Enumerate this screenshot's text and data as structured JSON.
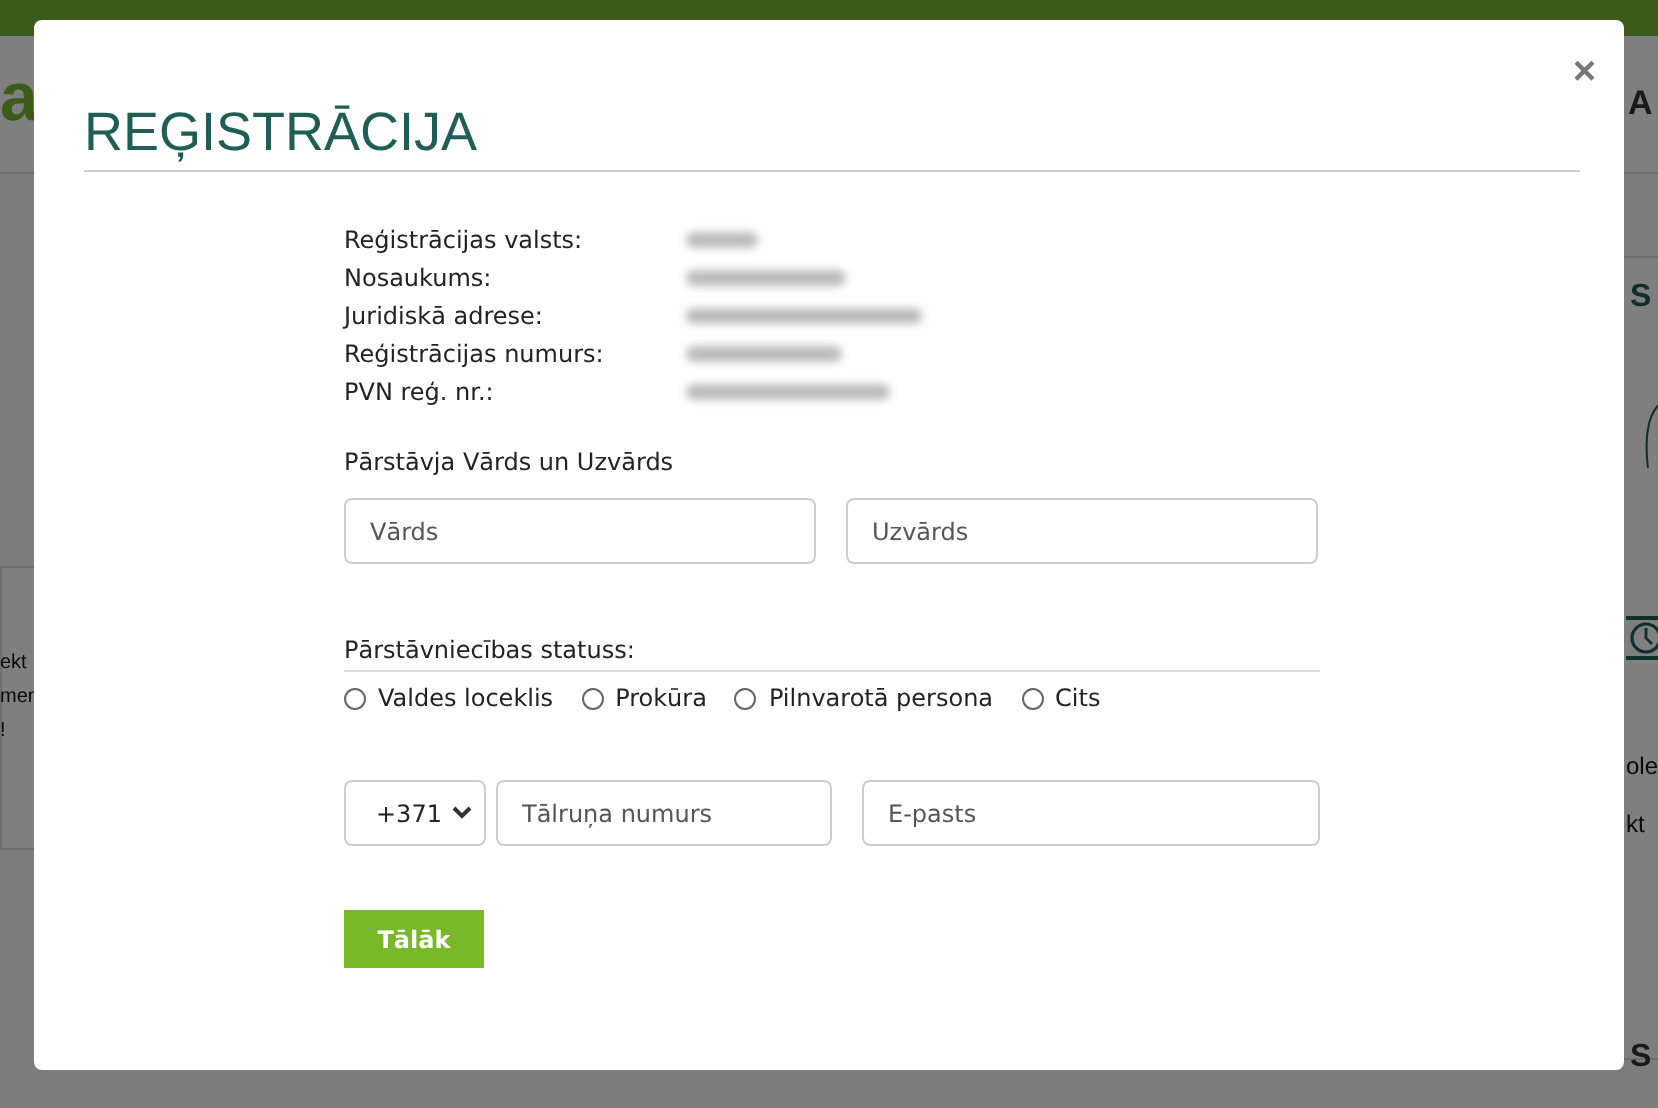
{
  "background_page": {
    "logo_fragment": "a",
    "fragments": [
      {
        "text": "A",
        "kind": "nav"
      },
      {
        "text": "S",
        "kind": "heading"
      },
      {
        "text": "ekt",
        "kind": "left"
      },
      {
        "text": "men",
        "kind": "left"
      },
      {
        "text": "!",
        "kind": "left"
      },
      {
        "text": "ole",
        "kind": "right"
      },
      {
        "text": "kt",
        "kind": "right"
      },
      {
        "text": "S",
        "kind": "bottom"
      }
    ]
  },
  "modal": {
    "title": "REĢISTRĀCIJA",
    "close": "×",
    "details": [
      {
        "label": "Reģistrācijas valsts:",
        "redacted": true
      },
      {
        "label": "Nosaukums:",
        "redacted": true
      },
      {
        "label": "Juridiskā adrese:",
        "redacted": true
      },
      {
        "label": "Reģistrācijas numurs:",
        "redacted": true
      },
      {
        "label": "PVN reģ. nr.:",
        "redacted": true
      }
    ],
    "name_section": {
      "label": "Pārstāvja Vārds un Uzvārds",
      "fields": [
        {
          "placeholder": "Vārds"
        },
        {
          "placeholder": "Uzvārds"
        }
      ]
    },
    "status": {
      "label": "Pārstāvniecības statuss:",
      "options": [
        {
          "label": "Valdes loceklis",
          "selected": false
        },
        {
          "label": "Prokūra",
          "selected": false
        },
        {
          "label": "Pilnvarotā persona",
          "selected": false
        },
        {
          "label": "Cits",
          "selected": false
        }
      ]
    },
    "contact": {
      "country_code": "+371",
      "phone": {
        "placeholder": "Tālruņa numurs"
      },
      "email": {
        "placeholder": "E-pasts"
      }
    },
    "submit": "Tālāk"
  }
}
